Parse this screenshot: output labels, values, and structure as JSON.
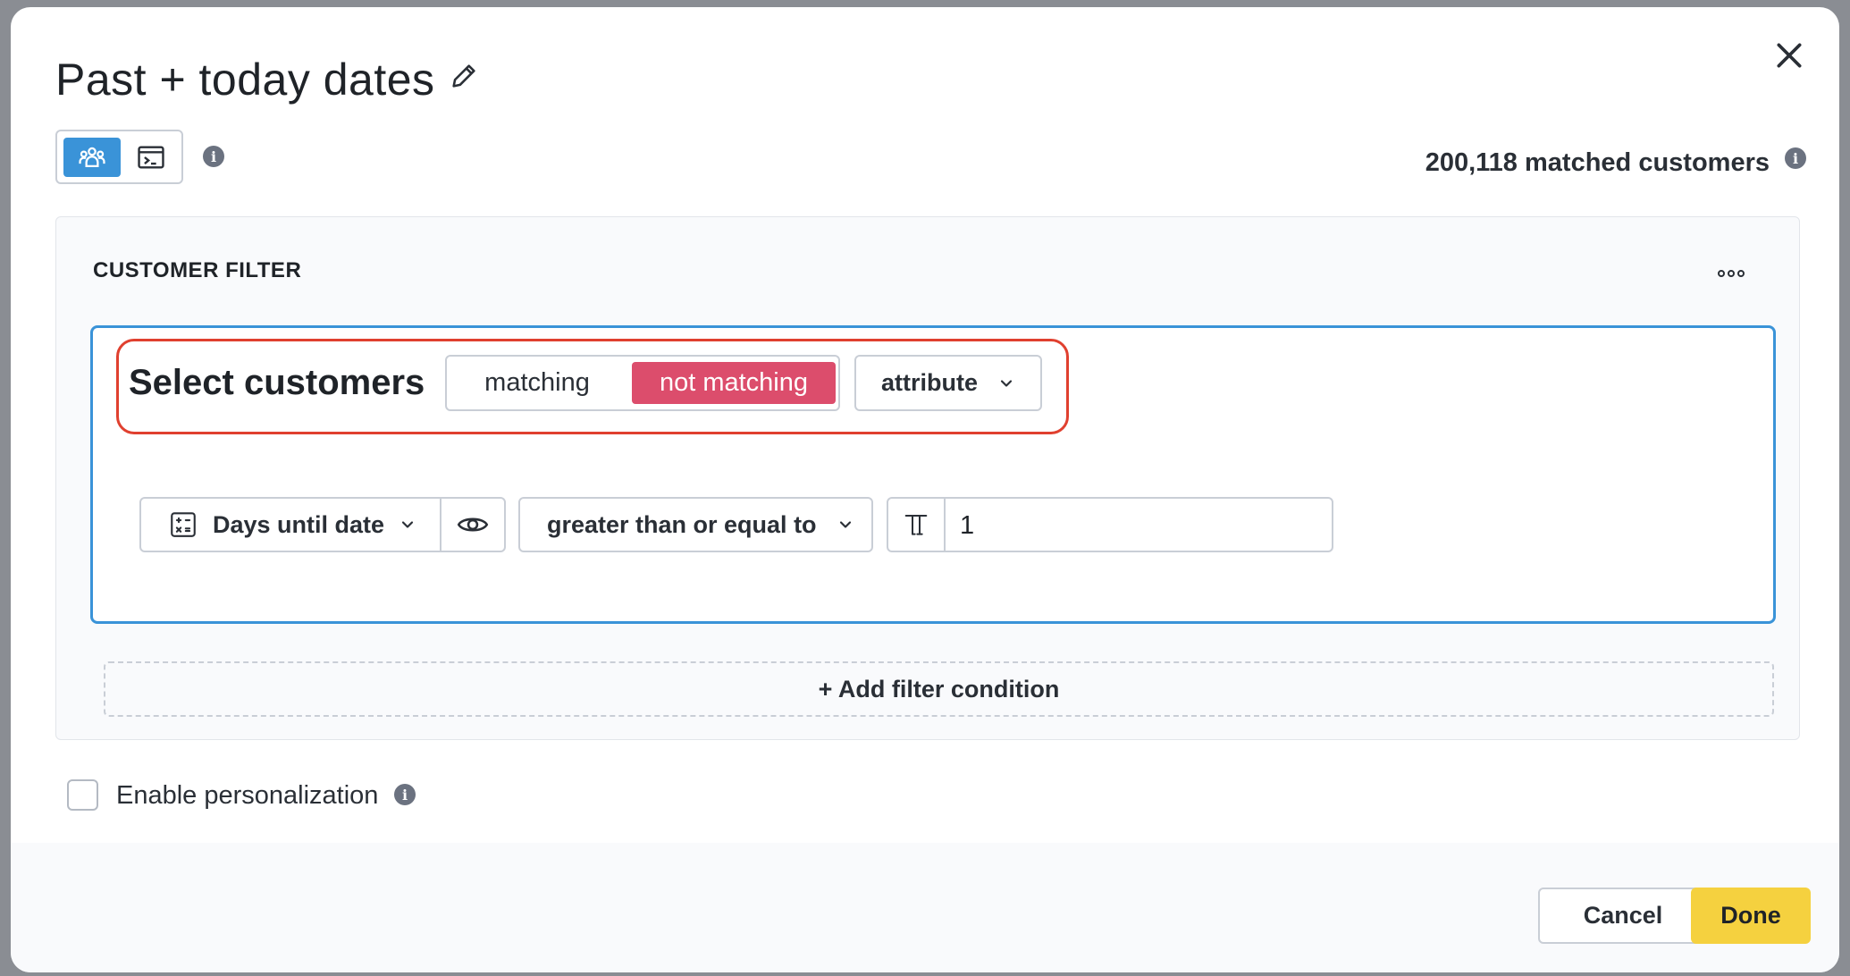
{
  "modal": {
    "title": "Past + today dates",
    "matched_count": "200,118",
    "matched_label": "matched customers"
  },
  "filter": {
    "section_label": "CUSTOMER FILTER",
    "select_label": "Select customers",
    "match_options": [
      "matching",
      "not matching"
    ],
    "match_selected": "not matching",
    "scope_select": "attribute",
    "condition": {
      "field": "Days until date",
      "operator": "greater than or equal to",
      "value": "1"
    },
    "add_condition_label": "+ Add filter condition"
  },
  "personalization": {
    "label": "Enable personalization",
    "checked": false
  },
  "footer": {
    "cancel_label": "Cancel",
    "done_label": "Done"
  },
  "colors": {
    "accent": "#3a93d8",
    "not_matching": "#dc4d6c",
    "highlight": "#e0402f",
    "done": "#f5d13f"
  },
  "icons": [
    "edit-icon",
    "close-icon",
    "audience-icon",
    "terminal-icon",
    "info-icon",
    "more-icon",
    "calculator-icon",
    "chevron-down-icon",
    "eye-icon",
    "text-type-icon"
  ]
}
